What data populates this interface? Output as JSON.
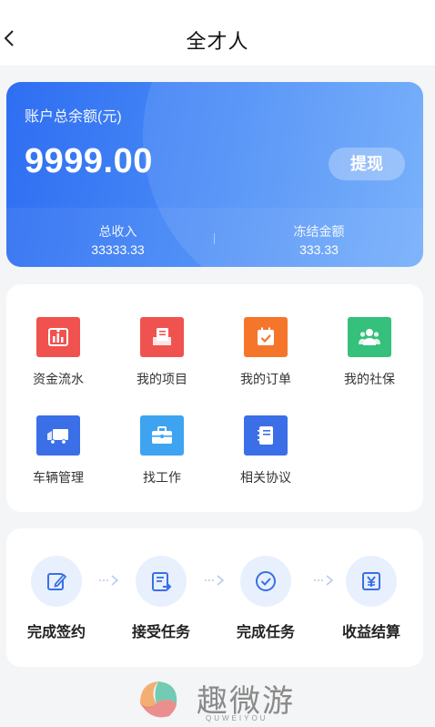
{
  "header": {
    "title": "全才人",
    "back_icon": "chevron-left-icon"
  },
  "balance_card": {
    "label": "账户总余额(元)",
    "amount": "9999.00",
    "withdraw_label": "提现",
    "total_income": {
      "label": "总收入",
      "value": "33333.33"
    },
    "frozen": {
      "label": "冻结金额",
      "value": "333.33"
    },
    "colors": {
      "gradient_start": "#2f6ef2",
      "gradient_end": "#6aa8fb"
    }
  },
  "menu": {
    "items": [
      {
        "label": "资金流水",
        "icon": "bar-chart-icon",
        "color": "#f0524f"
      },
      {
        "label": "我的项目",
        "icon": "project-icon",
        "color": "#f0524f"
      },
      {
        "label": "我的订单",
        "icon": "calendar-check-icon",
        "color": "#f5762b"
      },
      {
        "label": "我的社保",
        "icon": "people-icon",
        "color": "#35c07b"
      },
      {
        "label": "车辆管理",
        "icon": "truck-icon",
        "color": "#3a6fe8"
      },
      {
        "label": "找工作",
        "icon": "briefcase-icon",
        "color": "#3ea3f0"
      },
      {
        "label": "相关协议",
        "icon": "notebook-icon",
        "color": "#3a6fe8"
      }
    ]
  },
  "flow": {
    "steps": [
      {
        "label": "完成签约",
        "icon": "edit-icon"
      },
      {
        "label": "接受任务",
        "icon": "task-accept-icon"
      },
      {
        "label": "完成任务",
        "icon": "check-circle-icon"
      },
      {
        "label": "收益结算",
        "icon": "yuan-icon"
      }
    ],
    "accent": "#3a6fe8"
  },
  "watermark": {
    "text": "趣微游",
    "sub": "QUWEIYOU"
  }
}
